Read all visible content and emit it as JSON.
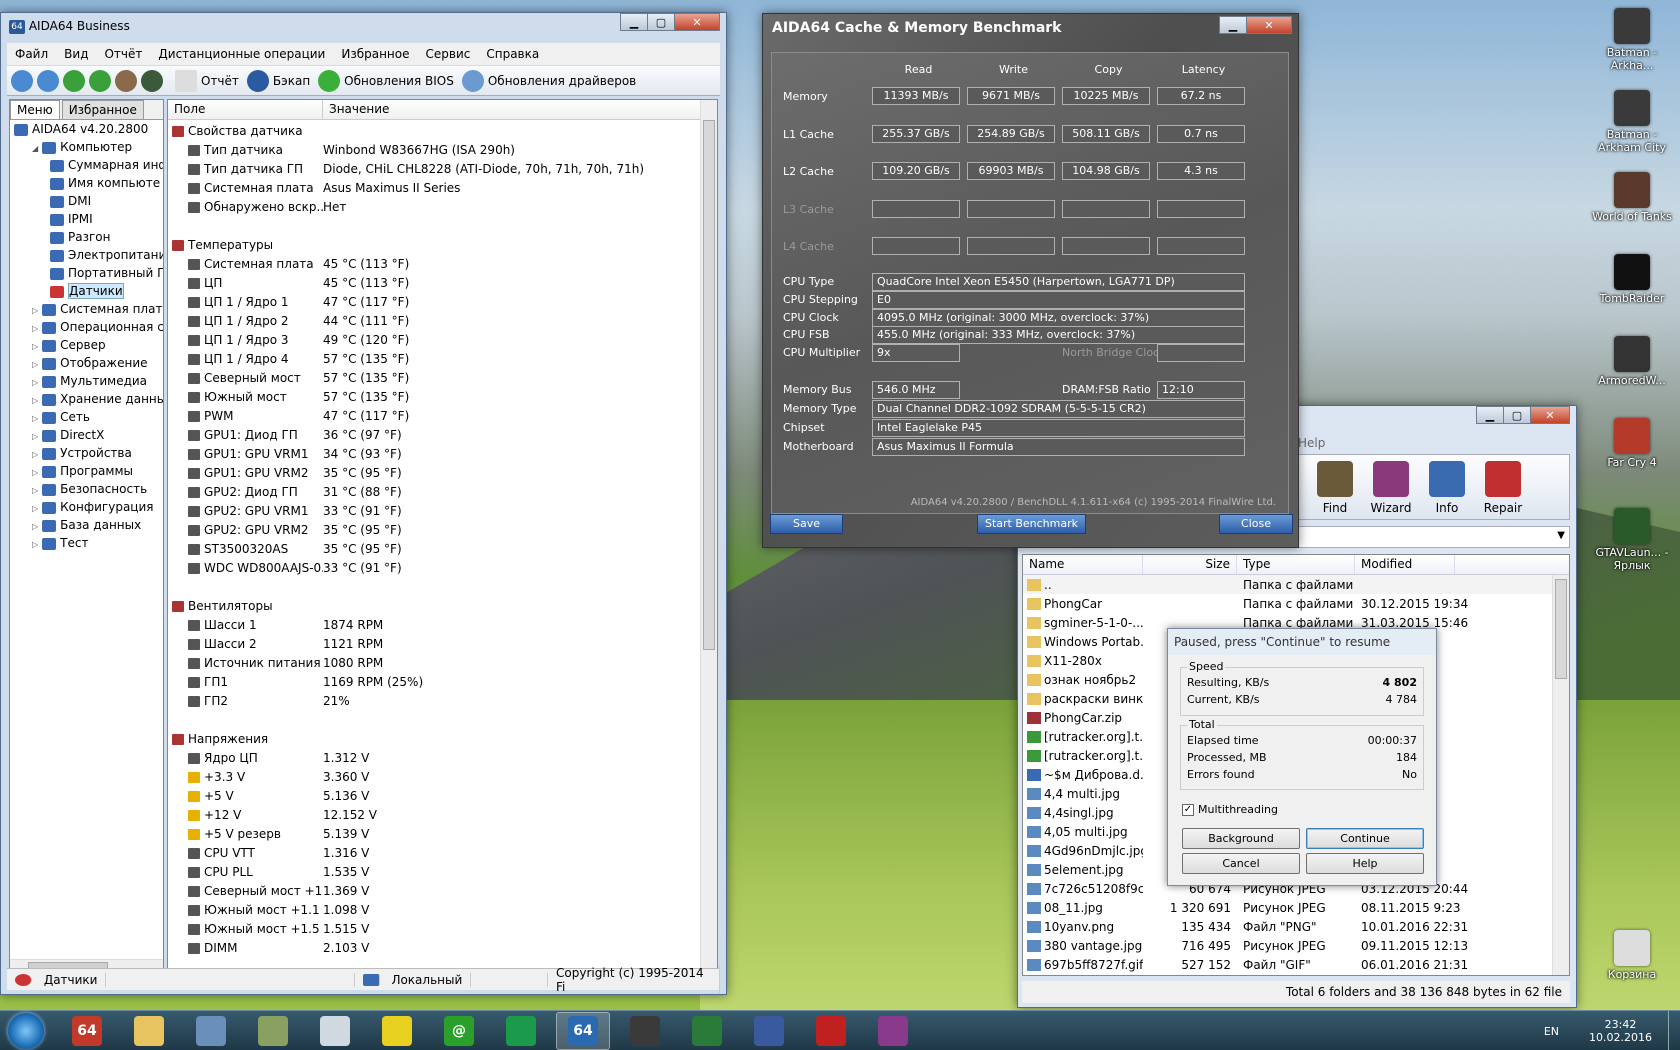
{
  "desktop": {
    "icons": [
      {
        "label": "Batman - Arkha...",
        "color": "#3a3a3a"
      },
      {
        "label": "Batman - Arkham City",
        "color": "#3a3a3a"
      },
      {
        "label": "World of Tanks",
        "color": "#5a3a2a"
      },
      {
        "label": "TombRaider",
        "color": "#111111"
      },
      {
        "label": "ArmoredW...",
        "color": "#333333"
      },
      {
        "label": "Far Cry 4",
        "color": "#b43a2a"
      },
      {
        "label": "GTAVLaun... - Ярлык",
        "color": "#2a5a2a"
      },
      {
        "label": "Корзина",
        "color": "#dddddd"
      }
    ]
  },
  "aida": {
    "title": "AIDA64 Business",
    "menu": [
      "Файл",
      "Вид",
      "Отчёт",
      "Дистанционные операции",
      "Избранное",
      "Сервис",
      "Справка"
    ],
    "toolbar": [
      "Отчёт",
      "Бэкап",
      "Обновления BIOS",
      "Обновления драйверов"
    ],
    "tabs": [
      "Меню",
      "Избранное"
    ],
    "tree": [
      {
        "label": "AIDA64 v4.20.2800",
        "indent": 0
      },
      {
        "label": "Компьютер",
        "indent": 1
      },
      {
        "label": "Суммарная инф",
        "indent": 2
      },
      {
        "label": "Имя компьюте",
        "indent": 2
      },
      {
        "label": "DMI",
        "indent": 2
      },
      {
        "label": "IPMI",
        "indent": 2
      },
      {
        "label": "Разгон",
        "indent": 2
      },
      {
        "label": "Электропитани",
        "indent": 2
      },
      {
        "label": "Портативный П",
        "indent": 2
      },
      {
        "label": "Датчики",
        "indent": 2,
        "selected": true
      },
      {
        "label": "Системная плата",
        "indent": 1
      },
      {
        "label": "Операционная сис",
        "indent": 1
      },
      {
        "label": "Сервер",
        "indent": 1
      },
      {
        "label": "Отображение",
        "indent": 1
      },
      {
        "label": "Мультимедиа",
        "indent": 1
      },
      {
        "label": "Хранение данных",
        "indent": 1
      },
      {
        "label": "Сеть",
        "indent": 1
      },
      {
        "label": "DirectX",
        "indent": 1
      },
      {
        "label": "Устройства",
        "indent": 1
      },
      {
        "label": "Программы",
        "indent": 1
      },
      {
        "label": "Безопасность",
        "indent": 1
      },
      {
        "label": "Конфигурация",
        "indent": 1
      },
      {
        "label": "База данных",
        "indent": 1
      },
      {
        "label": "Тест",
        "indent": 1
      }
    ],
    "columns": [
      "Поле",
      "Значение"
    ],
    "rows": [
      {
        "f": "Свойства датчика",
        "v": "",
        "sec": true
      },
      {
        "f": "Тип датчика",
        "v": "Winbond W83667HG  (ISA 290h)"
      },
      {
        "f": "Тип датчика ГП",
        "v": "Diode, CHiL CHL8228  (ATI-Diode, 70h, 71h, 70h, 71h)"
      },
      {
        "f": "Системная плата",
        "v": "Asus Maximus II Series"
      },
      {
        "f": "Обнаружено вскр...",
        "v": "Нет"
      },
      {
        "f": "",
        "v": "",
        "blank": true
      },
      {
        "f": "Температуры",
        "v": "",
        "sec": true
      },
      {
        "f": "Системная плата",
        "v": "45 °C  (113 °F)"
      },
      {
        "f": "ЦП",
        "v": "45 °C  (113 °F)"
      },
      {
        "f": "ЦП 1 / Ядро 1",
        "v": "47 °C  (117 °F)"
      },
      {
        "f": "ЦП 1 / Ядро 2",
        "v": "44 °C  (111 °F)"
      },
      {
        "f": "ЦП 1 / Ядро 3",
        "v": "49 °C  (120 °F)"
      },
      {
        "f": "ЦП 1 / Ядро 4",
        "v": "57 °C  (135 °F)"
      },
      {
        "f": "Северный мост",
        "v": "57 °C  (135 °F)"
      },
      {
        "f": "Южный мост",
        "v": "57 °C  (135 °F)"
      },
      {
        "f": "PWM",
        "v": "47 °C  (117 °F)"
      },
      {
        "f": "GPU1: Диод ГП",
        "v": "36 °C  (97 °F)"
      },
      {
        "f": "GPU1: GPU VRM1",
        "v": "34 °C  (93 °F)"
      },
      {
        "f": "GPU1: GPU VRM2",
        "v": "35 °C  (95 °F)"
      },
      {
        "f": "GPU2: Диод ГП",
        "v": "31 °C  (88 °F)"
      },
      {
        "f": "GPU2: GPU VRM1",
        "v": "33 °C  (91 °F)"
      },
      {
        "f": "GPU2: GPU VRM2",
        "v": "35 °C  (95 °F)"
      },
      {
        "f": "ST3500320AS",
        "v": "35 °C  (95 °F)"
      },
      {
        "f": "WDC WD800AAJS-0...",
        "v": "33 °C  (91 °F)"
      },
      {
        "f": "",
        "v": "",
        "blank": true
      },
      {
        "f": "Вентиляторы",
        "v": "",
        "sec": true
      },
      {
        "f": "Шасси 1",
        "v": "1874 RPM"
      },
      {
        "f": "Шасси 2",
        "v": "1121 RPM"
      },
      {
        "f": "Источник питания",
        "v": "1080 RPM"
      },
      {
        "f": "ГП1",
        "v": "1169 RPM  (25%)"
      },
      {
        "f": "ГП2",
        "v": "21%"
      },
      {
        "f": "",
        "v": "",
        "blank": true
      },
      {
        "f": "Напряжения",
        "v": "",
        "sec": true
      },
      {
        "f": "Ядро ЦП",
        "v": "1.312 V"
      },
      {
        "f": "+3.3 V",
        "v": "3.360 V"
      },
      {
        "f": "+5 V",
        "v": "5.136 V"
      },
      {
        "f": "+12 V",
        "v": "12.152 V"
      },
      {
        "f": "+5 V резерв",
        "v": "5.139 V"
      },
      {
        "f": "CPU VTT",
        "v": "1.316 V"
      },
      {
        "f": "CPU PLL",
        "v": "1.535 V"
      },
      {
        "f": "Северный мост +1....",
        "v": "1.369 V"
      },
      {
        "f": "Южный мост +1.1 V",
        "v": "1.098 V"
      },
      {
        "f": "Южный мост +1.5 V",
        "v": "1.515 V"
      },
      {
        "f": "DIMM",
        "v": "2.103 V"
      }
    ],
    "status": [
      "Датчики",
      "Локальный",
      "Copyright (c) 1995-2014 Fi"
    ]
  },
  "bench": {
    "title": "AIDA64 Cache & Memory Benchmark",
    "headers": [
      "Read",
      "Write",
      "Copy",
      "Latency"
    ],
    "rows": [
      {
        "label": "Memory",
        "vals": [
          "11393 MB/s",
          "9671 MB/s",
          "10225 MB/s",
          "67.2 ns"
        ]
      },
      {
        "label": "L1 Cache",
        "vals": [
          "255.37 GB/s",
          "254.89 GB/s",
          "508.11 GB/s",
          "0.7 ns"
        ]
      },
      {
        "label": "L2 Cache",
        "vals": [
          "109.20 GB/s",
          "69903 MB/s",
          "104.98 GB/s",
          "4.3 ns"
        ]
      },
      {
        "label": "L3 Cache",
        "vals": [
          "",
          "",
          "",
          ""
        ],
        "dim": true
      },
      {
        "label": "L4 Cache",
        "vals": [
          "",
          "",
          "",
          ""
        ],
        "dim": true
      }
    ],
    "info": [
      {
        "label": "CPU Type",
        "val": "QuadCore Intel Xeon E5450  (Harpertown, LGA771 DP)"
      },
      {
        "label": "CPU Stepping",
        "val": "E0"
      },
      {
        "label": "CPU Clock",
        "val": "4095.0 MHz  (original: 3000 MHz, overclock: 37%)"
      },
      {
        "label": "CPU FSB",
        "val": "455.0 MHz  (original: 333 MHz, overclock: 37%)"
      },
      {
        "label": "CPU Multiplier",
        "val": "9x",
        "extra_label": "North Bridge Clock",
        "extra_val": ""
      }
    ],
    "info2": [
      {
        "label": "Memory Bus",
        "val": "546.0 MHz",
        "extra_label": "DRAM:FSB Ratio",
        "extra_val": "12:10"
      },
      {
        "label": "Memory Type",
        "val": "Dual Channel DDR2-1092 SDRAM  (5-5-5-15 CR2)"
      },
      {
        "label": "Chipset",
        "val": "Intel Eaglelake P45"
      },
      {
        "label": "Motherboard",
        "val": "Asus Maximus II Formula"
      }
    ],
    "footer": "AIDA64 v4.20.2800 / BenchDLL 4.1.611-x64  (c) 1995-2014 FinalWire Ltd.",
    "buttons": [
      "Save",
      "Start Benchmark",
      "Close"
    ]
  },
  "fm": {
    "help": "Help",
    "ribbon": [
      "Find",
      "Wizard",
      "Info",
      "Repair"
    ],
    "columns": [
      "Name",
      "Size",
      "Type",
      "Modified"
    ],
    "files": [
      {
        "n": "..",
        "s": "",
        "t": "Папка с файлами",
        "m": "",
        "c": "#e8c460"
      },
      {
        "n": "PhongCar",
        "s": "",
        "t": "Папка с файлами",
        "m": "30.12.2015 19:34",
        "c": "#e8c460"
      },
      {
        "n": "sgminer-5-1-0-...",
        "s": "",
        "t": "Папка с файлами",
        "m": "31.03.2015 15:46",
        "c": "#e8c460"
      },
      {
        "n": "Windows Portab...",
        "s": "",
        "t": "",
        "m": "",
        "c": "#e8c460"
      },
      {
        "n": "X11-280x",
        "s": "",
        "t": "",
        "m": "",
        "c": "#e8c460"
      },
      {
        "n": "ознак ноябрь2",
        "s": "",
        "t": "",
        "m": "",
        "c": "#e8c460"
      },
      {
        "n": "раскраски винкс",
        "s": "",
        "t": "",
        "m": "",
        "c": "#e8c460"
      },
      {
        "n": "PhongCar.zip",
        "s": "",
        "t": "",
        "m": "",
        "c": "#a0303a"
      },
      {
        "n": "[rutracker.org].t...",
        "s": "",
        "t": "",
        "m": "",
        "c": "#3a9a3a"
      },
      {
        "n": "[rutracker.org].t...",
        "s": "",
        "t": "",
        "m": "",
        "c": "#3a9a3a"
      },
      {
        "n": "~$м Диброва.d...",
        "s": "",
        "t": "",
        "m": "",
        "c": "#3a6ab3"
      },
      {
        "n": "4,4 multi.jpg",
        "s": "",
        "t": "",
        "m": "",
        "c": "#5a8ac0"
      },
      {
        "n": "4,4singl.jpg",
        "s": "",
        "t": "",
        "m": "",
        "c": "#5a8ac0"
      },
      {
        "n": "4,05 multi.jpg",
        "s": "",
        "t": "",
        "m": "",
        "c": "#5a8ac0"
      },
      {
        "n": "4Gd96nDmjlc.jpg",
        "s": "",
        "t": "",
        "m": "",
        "c": "#5a8ac0"
      },
      {
        "n": "5element.jpg",
        "s": "",
        "t": "",
        "m": "",
        "c": "#5a8ac0"
      },
      {
        "n": "7c726c51208f9c...",
        "s": "60 674",
        "t": "Рисунок JPEG",
        "m": "03.12.2015 20:44",
        "c": "#5a8ac0"
      },
      {
        "n": "08_11.jpg",
        "s": "1 320 691",
        "t": "Рисунок JPEG",
        "m": "08.11.2015 9:23",
        "c": "#5a8ac0"
      },
      {
        "n": "10yanv.png",
        "s": "135 434",
        "t": "Файл \"PNG\"",
        "m": "10.01.2016 22:31",
        "c": "#5a8ac0"
      },
      {
        "n": "380 vantage.jpg",
        "s": "716 495",
        "t": "Рисунок JPEG",
        "m": "09.11.2015 12:13",
        "c": "#5a8ac0"
      },
      {
        "n": "697b5ff8727f.gif",
        "s": "527 152",
        "t": "Файл \"GIF\"",
        "m": "06.01.2016 21:31",
        "c": "#5a8ac0"
      }
    ],
    "status": "Total 6 folders and 38 136 848 bytes in 62 file"
  },
  "progress": {
    "title": "Paused, press \"Continue\" to resume",
    "speed_label": "Speed",
    "speed": [
      {
        "k": "Resulting, KB/s",
        "v": "4 802"
      },
      {
        "k": "Current, KB/s",
        "v": "4 784"
      }
    ],
    "total_label": "Total",
    "total": [
      {
        "k": "Elapsed time",
        "v": "00:00:37"
      },
      {
        "k": "Processed, MB",
        "v": "184"
      },
      {
        "k": "Errors found",
        "v": "No"
      }
    ],
    "multithreading": "Multithreading",
    "buttons": [
      "Background",
      "Continue",
      "Cancel",
      "Help"
    ]
  },
  "taskbar": {
    "apps": [
      "#c0392b",
      "#e8c460",
      "#6a8fb8",
      "#8aa060",
      "#d0d8e0",
      "#e8d020",
      "#2aa02a",
      "#1a9a4a",
      "#2a6ab0",
      "#3a3a3a",
      "#2a7a3a",
      "#3a5aa0",
      "#c02020",
      "#8a3a8a"
    ],
    "apps_labels": [
      "64",
      "",
      "",
      "",
      "",
      "",
      "@",
      "",
      "64",
      "",
      "",
      "",
      "",
      ""
    ],
    "lang": "EN",
    "time": "23:42",
    "date": "10.02.2016"
  }
}
